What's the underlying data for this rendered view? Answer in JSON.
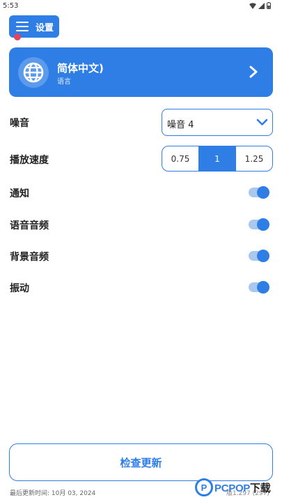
{
  "status_bar": {
    "time": "5:53",
    "icons": [
      "wifi-icon",
      "signal-icon",
      "battery-icon"
    ]
  },
  "header": {
    "settings_label": "设置",
    "icon": "hamburger-menu-icon",
    "has_notification_dot": true
  },
  "language_card": {
    "title": "简体中文)",
    "subtitle": "语言",
    "icon": "globe-icon",
    "chevron": "chevron-right-icon"
  },
  "noise": {
    "label": "噪音",
    "selected": "噪音 4"
  },
  "playback_speed": {
    "label": "播放速度",
    "options": [
      "0.75",
      "1",
      "1.25"
    ],
    "selected": "1"
  },
  "toggles": [
    {
      "label": "通知",
      "on": true
    },
    {
      "label": "语音音频",
      "on": true
    },
    {
      "label": "背景音频",
      "on": true
    },
    {
      "label": "振动",
      "on": true
    }
  ],
  "check_update_label": "检查更新",
  "footer": {
    "last_update": "最后更新时间:   10月 03, 2024",
    "version": "版1.297 (297)"
  },
  "watermark": {
    "brand": "PCPOP",
    "suffix": "下载"
  },
  "colors": {
    "accent": "#2f7ee6",
    "toggle_track": "#a8c8f0",
    "badge": "#e0465e"
  }
}
